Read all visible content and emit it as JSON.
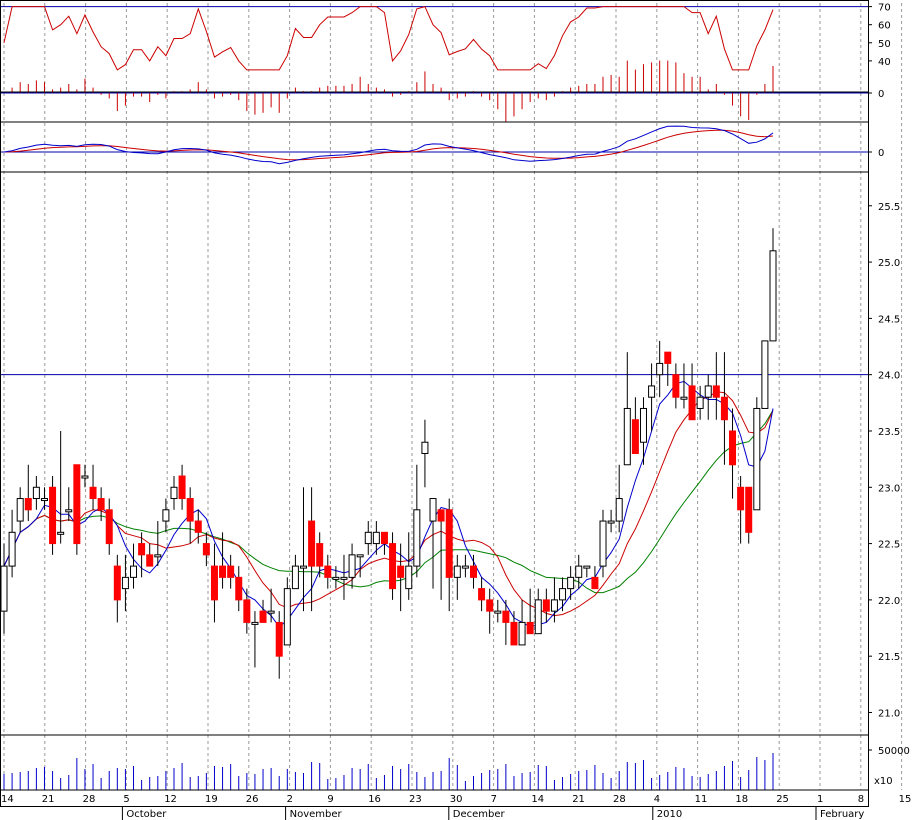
{
  "chart_data": {
    "type": "candlestick",
    "x_axis": {
      "day_labels": [
        "14",
        "21",
        "28",
        "5",
        "12",
        "19",
        "26",
        "2",
        "9",
        "16",
        "23",
        "30",
        "7",
        "14",
        "21",
        "28",
        "4",
        "11",
        "18",
        "25",
        "1",
        "8",
        "15"
      ],
      "month_labels": [
        "October",
        "November",
        "December",
        "2010",
        "February"
      ]
    },
    "panels": {
      "rsi": {
        "ticks": [
          70,
          60,
          50,
          40
        ],
        "line_level": 70,
        "colors": {
          "line": "#cc0000"
        }
      },
      "momentum": {
        "ticks": [
          0
        ],
        "colors": {
          "bars": "#cc0000"
        }
      },
      "macd": {
        "ticks": [
          0
        ],
        "colors": {
          "macd": "#0000cc",
          "signal": "#cc0000"
        }
      },
      "price": {
        "ticks": [
          25.5,
          25.0,
          24.5,
          24.0,
          23.5,
          23.0,
          22.5,
          22.0,
          21.5,
          21.0
        ],
        "ylim": [
          20.8,
          25.8
        ],
        "horizontal_line": 24.0,
        "colors": {
          "up": "#ffffff",
          "down": "#ff0000",
          "ma_fast": "#0000cc",
          "ma_mid": "#cc0000",
          "ma_slow": "#008000"
        },
        "candles": [
          [
            21.9,
            22.3,
            21.7,
            22.5
          ],
          [
            22.3,
            22.6,
            22.2,
            22.8
          ],
          [
            22.7,
            22.9,
            22.6,
            23.0
          ],
          [
            22.9,
            22.8,
            22.7,
            23.2
          ],
          [
            22.9,
            23.0,
            22.8,
            23.1
          ],
          [
            22.9,
            22.9,
            22.8,
            23.0
          ],
          [
            23.0,
            22.5,
            22.4,
            23.1
          ],
          [
            22.6,
            22.6,
            22.5,
            23.5
          ],
          [
            22.8,
            22.8,
            22.7,
            23.0
          ],
          [
            23.2,
            22.5,
            22.4,
            23.2
          ],
          [
            23.1,
            23.1,
            23.0,
            23.2
          ],
          [
            23.0,
            22.9,
            22.8,
            23.2
          ],
          [
            22.9,
            22.8,
            22.7,
            23.0
          ],
          [
            22.8,
            22.5,
            22.4,
            22.9
          ],
          [
            22.3,
            22.0,
            21.8,
            22.4
          ],
          [
            22.1,
            22.2,
            21.9,
            22.4
          ],
          [
            22.2,
            22.3,
            22.1,
            22.5
          ],
          [
            22.5,
            22.4,
            22.2,
            22.6
          ],
          [
            22.4,
            22.3,
            22.3,
            22.5
          ],
          [
            22.4,
            22.4,
            22.3,
            22.7
          ],
          [
            22.7,
            22.8,
            22.6,
            22.9
          ],
          [
            22.9,
            23.0,
            22.8,
            23.1
          ],
          [
            23.1,
            22.9,
            22.8,
            23.2
          ],
          [
            22.9,
            22.7,
            22.5,
            23.0
          ],
          [
            22.7,
            22.6,
            22.5,
            22.8
          ],
          [
            22.5,
            22.4,
            22.3,
            22.6
          ],
          [
            22.3,
            22.0,
            21.8,
            22.5
          ],
          [
            22.3,
            22.2,
            22.1,
            22.6
          ],
          [
            22.3,
            22.2,
            22.1,
            22.4
          ],
          [
            22.2,
            22.0,
            21.9,
            22.3
          ],
          [
            22.0,
            21.8,
            21.7,
            22.1
          ],
          [
            21.8,
            21.8,
            21.4,
            21.9
          ],
          [
            21.9,
            21.8,
            21.8,
            22.0
          ],
          [
            21.9,
            21.9,
            21.8,
            22.1
          ],
          [
            21.8,
            21.5,
            21.3,
            21.9
          ],
          [
            21.6,
            22.1,
            21.6,
            22.2
          ],
          [
            22.1,
            22.3,
            22.1,
            22.4
          ],
          [
            22.3,
            22.3,
            21.9,
            23.0
          ],
          [
            22.7,
            22.3,
            21.9,
            23.0
          ],
          [
            22.5,
            22.3,
            22.2,
            22.6
          ],
          [
            22.3,
            22.2,
            22.1,
            22.4
          ],
          [
            22.2,
            22.2,
            22.1,
            22.3
          ],
          [
            22.2,
            22.2,
            22.0,
            22.4
          ],
          [
            22.2,
            22.4,
            22.1,
            22.5
          ],
          [
            22.4,
            22.4,
            22.2,
            22.4
          ],
          [
            22.5,
            22.6,
            22.4,
            22.7
          ],
          [
            22.5,
            22.6,
            22.4,
            22.7
          ],
          [
            22.6,
            22.5,
            22.4,
            22.6
          ],
          [
            22.5,
            22.1,
            22.0,
            22.6
          ],
          [
            22.3,
            22.2,
            21.9,
            22.5
          ],
          [
            22.1,
            22.3,
            22.0,
            22.6
          ],
          [
            22.3,
            22.8,
            22.2,
            23.2
          ],
          [
            23.3,
            23.4,
            23.0,
            23.6
          ],
          [
            22.7,
            22.9,
            22.1,
            22.9
          ],
          [
            22.8,
            22.7,
            22.0,
            22.8
          ],
          [
            22.8,
            22.2,
            21.9,
            22.9
          ],
          [
            22.2,
            22.3,
            22.0,
            22.4
          ],
          [
            22.3,
            22.3,
            22.2,
            22.4
          ],
          [
            22.3,
            22.2,
            22.1,
            22.4
          ],
          [
            22.1,
            22.0,
            21.9,
            22.2
          ],
          [
            22.0,
            21.9,
            21.7,
            22.1
          ],
          [
            21.9,
            21.9,
            21.8,
            22.0
          ],
          [
            21.9,
            21.8,
            21.6,
            22.0
          ],
          [
            21.8,
            21.6,
            21.6,
            21.9
          ],
          [
            21.6,
            21.8,
            21.6,
            22.0
          ],
          [
            21.8,
            21.7,
            21.7,
            22.1
          ],
          [
            21.7,
            22.0,
            21.7,
            22.1
          ],
          [
            22.0,
            21.9,
            21.8,
            22.1
          ],
          [
            21.9,
            22.0,
            21.8,
            22.2
          ],
          [
            22.0,
            22.1,
            21.9,
            22.2
          ],
          [
            22.1,
            22.2,
            22.0,
            22.3
          ],
          [
            22.2,
            22.3,
            22.1,
            22.4
          ],
          [
            22.3,
            22.3,
            22.2,
            22.3
          ],
          [
            22.2,
            22.1,
            22.1,
            22.3
          ],
          [
            22.3,
            22.7,
            22.2,
            22.8
          ],
          [
            22.7,
            22.7,
            22.6,
            22.8
          ],
          [
            22.7,
            22.9,
            22.6,
            23.2
          ],
          [
            23.2,
            23.7,
            23.2,
            24.2
          ],
          [
            23.6,
            23.3,
            23.3,
            23.8
          ],
          [
            23.4,
            23.7,
            23.2,
            23.8
          ],
          [
            23.8,
            23.9,
            23.5,
            24.1
          ],
          [
            24.0,
            24.1,
            23.8,
            24.3
          ],
          [
            24.2,
            24.1,
            23.9,
            24.2
          ],
          [
            24.0,
            23.8,
            23.7,
            24.1
          ],
          [
            23.8,
            23.8,
            23.7,
            24.1
          ],
          [
            23.9,
            23.6,
            23.6,
            24.1
          ],
          [
            23.7,
            23.8,
            23.6,
            23.9
          ],
          [
            23.8,
            23.9,
            23.6,
            24.0
          ],
          [
            23.9,
            23.8,
            23.6,
            24.2
          ],
          [
            23.8,
            23.6,
            23.2,
            24.2
          ],
          [
            23.5,
            23.2,
            22.9,
            23.7
          ],
          [
            23.0,
            22.8,
            22.5,
            23.1
          ],
          [
            23.0,
            22.6,
            22.5,
            23.0
          ],
          [
            22.8,
            23.7,
            22.8,
            23.8
          ],
          [
            23.7,
            24.3,
            23.7,
            24.3
          ],
          [
            24.3,
            25.1,
            24.3,
            25.3
          ]
        ]
      }
    },
    "volume": {
      "ticks": [
        50000
      ],
      "multiplier_label": "x10",
      "colors": {
        "bars": "#0000cc"
      }
    }
  }
}
